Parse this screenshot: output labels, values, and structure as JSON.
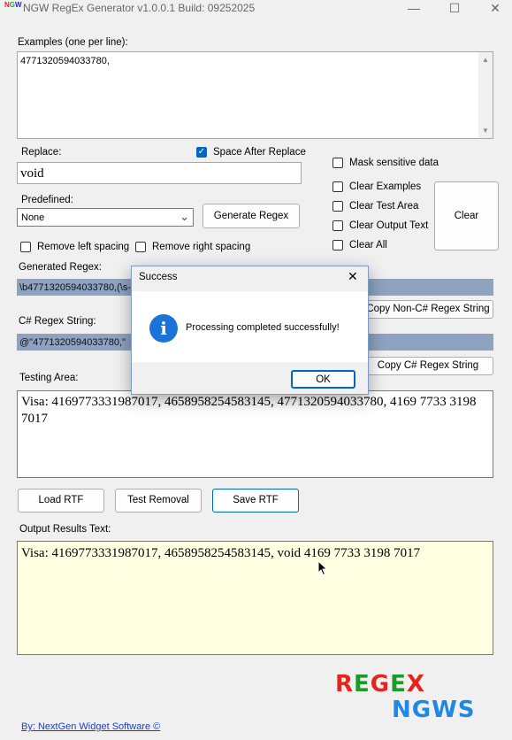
{
  "window": {
    "title": "NGW RegEx Generator v1.0.0.1 Build: 09252025",
    "minimize": "—",
    "maximize": "☐",
    "close": "✕"
  },
  "examples": {
    "label": "Examples (one per line):",
    "value": "4771320594033780,"
  },
  "replace": {
    "label": "Replace:",
    "value": "void",
    "space_after_label": "Space After Replace",
    "space_after_checked": true
  },
  "predefined": {
    "label": "Predefined:",
    "selected": "None"
  },
  "buttons": {
    "generate": "Generate Regex",
    "clear": "Clear",
    "copy_non_cs": "Copy Non-C# Regex String",
    "copy_cs": "Copy C# Regex String",
    "load_rtf": "Load RTF",
    "test_removal": "Test Removal",
    "save_rtf": "Save RTF"
  },
  "options": {
    "mask_sensitive": "Mask sensitive data",
    "clear_examples": "Clear Examples",
    "clear_test_area": "Clear Test Area",
    "clear_output_text": "Clear Output Text",
    "clear_all": "Clear All",
    "remove_left": "Remove left spacing",
    "remove_right": "Remove right spacing"
  },
  "generated": {
    "label": "Generated Regex:",
    "value": "\\b4771320594033780,(\\s-"
  },
  "csharp": {
    "label": "C# Regex String:",
    "value": "@\"4771320594033780,\""
  },
  "testing": {
    "label": "Testing Area:",
    "value": "Visa: 4169773331987017, 4658958254583145, 4771320594033780, 4169 7733 3198 7017"
  },
  "output": {
    "label": "Output Results Text:",
    "value": "Visa: 4169773331987017, 4658958254583145, void 4169 7733 3198 7017"
  },
  "dialog": {
    "title": "Success",
    "message": "Processing completed successfully!",
    "ok": "OK",
    "close": "✕",
    "icon_glyph": "i"
  },
  "footer": {
    "link": "By: NextGen Widget Software  ©",
    "brand_regex": [
      "R",
      "E",
      "G",
      "E",
      "X"
    ],
    "brand_news": "NGWS",
    "brand_colors": [
      "#e8231c",
      "#1c9b2a",
      "#e8231c",
      "#1c9b2a",
      "#e8231c"
    ],
    "news_color": "#1e88e5"
  }
}
